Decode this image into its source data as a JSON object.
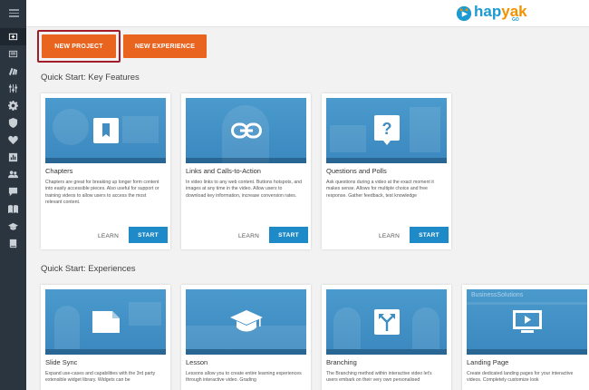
{
  "sidebar": {
    "items": [
      {
        "icon": "hamburger-menu-icon"
      },
      {
        "icon": "create-project-icon"
      },
      {
        "icon": "list-icon"
      },
      {
        "icon": "library-icon"
      },
      {
        "icon": "sliders-icon"
      },
      {
        "icon": "gear-icon"
      },
      {
        "icon": "shield-icon"
      },
      {
        "icon": "heart-icon"
      },
      {
        "icon": "analytics-icon"
      },
      {
        "icon": "people-icon"
      },
      {
        "icon": "chat-icon"
      },
      {
        "icon": "book-open-icon"
      },
      {
        "icon": "graduation-cap-icon"
      },
      {
        "icon": "book-icon"
      }
    ]
  },
  "header": {
    "logo": {
      "hap": "hap",
      "yak": "yak",
      "sub": "GO"
    }
  },
  "actions": {
    "new_project": "NEW PROJECT",
    "new_experience": "NEW EXPERIENCE"
  },
  "sections": {
    "key_features_title": "Quick Start: Key Features",
    "experiences_title": "Quick Start: Experiences"
  },
  "features": [
    {
      "title": "Chapters",
      "desc": "Chapters are great for breaking up longer form content into easily accessible pieces. Also useful for support or training videos to allow users to access the most relevant content.",
      "learn": "LEARN",
      "start": "START",
      "icon": "bookmark-icon"
    },
    {
      "title": "Links and Calls-to-Action",
      "desc": "In video links to any web content. Buttons hotspots, and images at any time in the video. Allow users to download key information, increase conversion rates.",
      "learn": "LEARN",
      "start": "START",
      "icon": "link-icon"
    },
    {
      "title": "Questions and Polls",
      "desc": "Ask questions during a video at the exact moment it makes sense. Allows for multiple choice and free response. Gather feedback, test knowledge",
      "learn": "LEARN",
      "start": "START",
      "icon": "question-icon"
    }
  ],
  "experiences": [
    {
      "title": "Slide Sync",
      "desc": "Expand use-cases and capabilities with the 3rd party extensible widget library. Widgets can be",
      "icon": "slide-icon"
    },
    {
      "title": "Lesson",
      "desc": "Lessons allow you to create entire learning experiences through interactive video. Grading",
      "icon": "graduation-cap-icon"
    },
    {
      "title": "Branching",
      "desc": "The Branching method within interactive video let's users embark on their very own personalised",
      "icon": "branch-arrows-icon"
    },
    {
      "title": "Landing Page",
      "desc": "Create dedicated landing pages for your interactive videos. Completely customize look",
      "icon": "monitor-play-icon",
      "thumb_text": "BusinessSolutions"
    }
  ],
  "colors": {
    "sidebar": "#2b3540",
    "accent_orange": "#e8641f",
    "highlight_border": "#a11d2c",
    "start_blue": "#1e8ac8",
    "thumb_blue": "#3f8dc2"
  }
}
